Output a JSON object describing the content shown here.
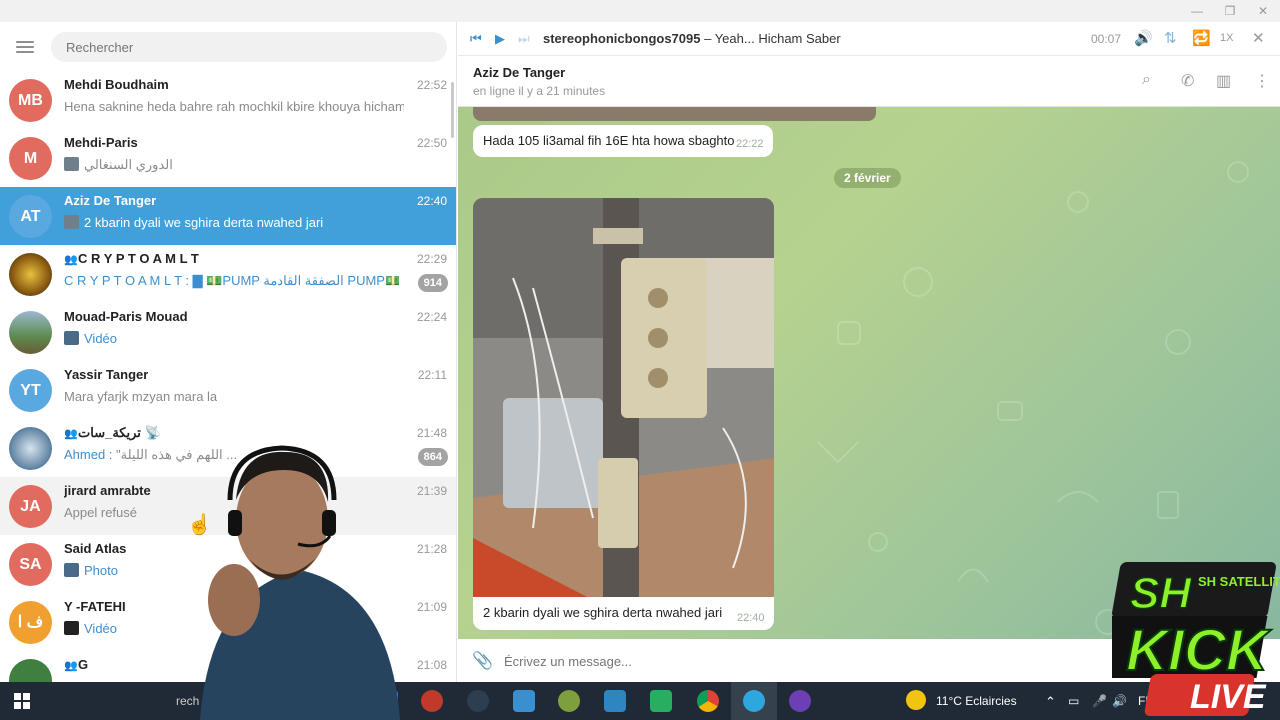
{
  "window": {
    "minimize": "—",
    "maximize": "❐",
    "close": "✕"
  },
  "search": {
    "placeholder": "Rechercher"
  },
  "chats": [
    {
      "initials": "MB",
      "color": "#e26b5f",
      "name": "Mehdi Boudhaim",
      "time": "22:52",
      "preview": "Hena saknine heda bahre rah mochkil kbire khouya hicham"
    },
    {
      "initials": "M",
      "color": "#e26b5f",
      "name": "Mehdi-Paris",
      "time": "22:50",
      "preview": "الدوري السنغالي"
    },
    {
      "initials": "AT",
      "color": "#5aa8e0",
      "name": "Aziz De Tanger",
      "time": "22:40",
      "preview": "2 kbarin dyali we sghira derta nwahed jari"
    },
    {
      "initials": "",
      "color": "#c79a2a",
      "name": "C R Y P T O A M L T",
      "time": "22:29",
      "preview": "C R Y P T O A M L T : ▇ 💵PUMP  الصفقة القادمة PUMP💵...",
      "badge": "914"
    },
    {
      "initials": "",
      "color": "#6b8f5c",
      "name": "Mouad-Paris Mouad",
      "time": "22:24",
      "preview": "Vidéo"
    },
    {
      "initials": "YT",
      "color": "#5aa8e0",
      "name": "Yassir Tanger",
      "time": "22:11",
      "preview": "Mara yfarjk mzyan mara la"
    },
    {
      "initials": "",
      "color": "#5b7fa0",
      "name": "تريكة_سات 📡",
      "time": "21:48",
      "preview_sender": "Ahmed :",
      "preview": "\"اللهم في هذه الليلة ...",
      "badge": "864"
    },
    {
      "initials": "JA",
      "color": "#e26b5f",
      "name": "jirard amrabte",
      "time": "21:39",
      "preview": "Appel refusé"
    },
    {
      "initials": "SA",
      "color": "#e26b5f",
      "name": "Said Atlas",
      "time": "21:28",
      "preview": "Photo"
    },
    {
      "initials": "ف ا",
      "color": "#f0a030",
      "name": "Y -FATEHI",
      "time": "21:09",
      "preview": "Vidéo"
    },
    {
      "initials": "",
      "color": "#3f7f3f",
      "name": "G",
      "time": "21:08",
      "preview": ""
    }
  ],
  "player": {
    "track_title": "stereophonicbongos7095",
    "track_rest": " – Yeah... Hicham Saber",
    "time": "00:07",
    "speed": "1X"
  },
  "conversation": {
    "name": "Aziz De Tanger",
    "status": "en ligne il y a 21 minutes"
  },
  "messages": [
    {
      "text": "Hada 105 li3amal fih 16E hta howa  sbaghto",
      "time": "22:22"
    },
    {
      "date": "2 février"
    },
    {
      "caption": "2 kbarin dyali we sghira derta nwahed jari",
      "time": "22:40"
    }
  ],
  "composer": {
    "placeholder": "Écrivez un message..."
  },
  "taskbar": {
    "weather": "11°C  Eclaircies",
    "lang": "FRA",
    "search_fragment": "rech"
  },
  "overlay": {
    "logo_top": "SH SATELLITE",
    "logo_mid": "KICK",
    "logo_bottom": "LIVE"
  }
}
